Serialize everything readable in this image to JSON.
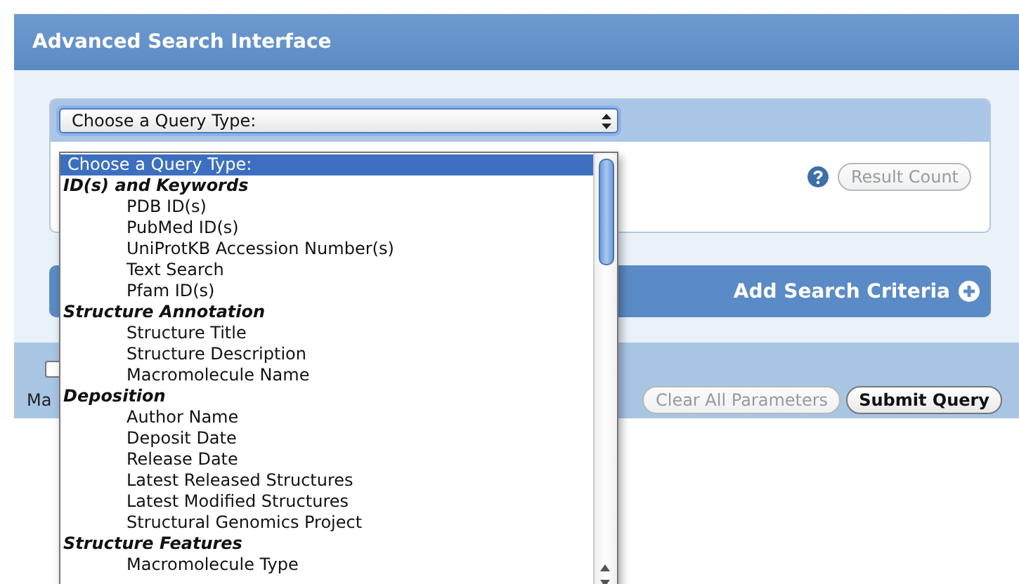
{
  "header": {
    "title": "Advanced Search Interface"
  },
  "query_select": {
    "value": "Choose a Query Type:",
    "expanded": true
  },
  "result_count_button": {
    "label": "Result Count",
    "disabled": true
  },
  "add_criteria_button": {
    "label": "Add Search Criteria"
  },
  "options_row": {
    "checked": false,
    "label": "Ma"
  },
  "buttons": [
    {
      "label": "Clear All Parameters",
      "disabled": true
    },
    {
      "label": "Submit Query",
      "disabled": false
    }
  ],
  "dropdown_list": {
    "items": [
      {
        "kind": "option",
        "label": "Choose a Query Type:",
        "selected": true
      },
      {
        "kind": "group",
        "label": "ID(s) and Keywords",
        "children": [
          {
            "label": "PDB ID(s)",
            "selected": false
          },
          {
            "label": "PubMed ID(s)",
            "selected": false
          },
          {
            "label": "UniProtKB Accession Number(s)",
            "selected": false
          },
          {
            "label": "Text Search",
            "selected": false
          },
          {
            "label": "Pfam ID(s)",
            "selected": false
          }
        ]
      },
      {
        "kind": "group",
        "label": "Structure Annotation",
        "children": [
          {
            "label": "Structure Title",
            "selected": false
          },
          {
            "label": "Structure Description",
            "selected": false
          },
          {
            "label": "Macromolecule Name",
            "selected": false
          }
        ]
      },
      {
        "kind": "group",
        "label": "Deposition",
        "children": [
          {
            "label": "Author Name",
            "selected": false
          },
          {
            "label": "Deposit Date",
            "selected": false
          },
          {
            "label": "Release Date",
            "selected": false
          },
          {
            "label": "Latest Released Structures",
            "selected": false
          },
          {
            "label": "Latest Modified Structures",
            "selected": false
          },
          {
            "label": "Structural Genomics Project",
            "selected": false
          }
        ]
      },
      {
        "kind": "group",
        "label": "Structure Features",
        "children": [
          {
            "label": "Macromolecule Type",
            "selected": false
          }
        ]
      }
    ]
  }
}
